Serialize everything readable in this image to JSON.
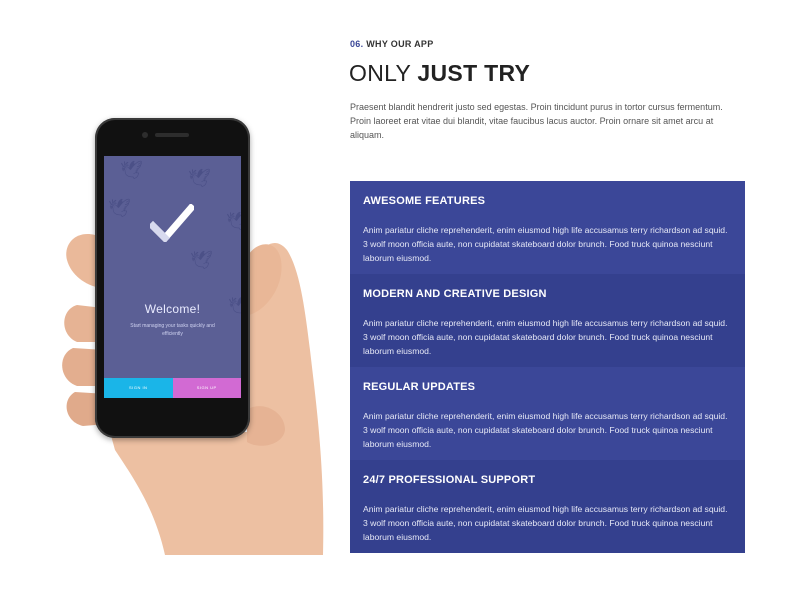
{
  "section": {
    "number": "06.",
    "eyebrow": "WHY OUR APP",
    "title_light": "ONLY",
    "title_bold": "JUST TRY",
    "intro": "Praesent blandit hendrerit justo sed egestas. Proin tincidunt purus in tortor cursus fermentum. Proin laoreet erat vitae dui blandit, vitae faucibus lacus auctor. Proin ornare sit amet arcu at aliquam."
  },
  "phone_screen": {
    "welcome": "Welcome!",
    "subtitle": "Start managing your tasks quickly and efficiently",
    "sign_in": "SIGN IN",
    "sign_up": "SIGN UP"
  },
  "features": [
    {
      "title": "AWESOME FEATURES",
      "text": "Anim pariatur cliche reprehenderit, enim eiusmod high life accusamus terry richardson ad squid. 3 wolf moon officia aute, non cupidatat skateboard dolor brunch. Food truck quinoa nesciunt laborum eiusmod."
    },
    {
      "title": "MODERN AND CREATIVE DESIGN",
      "text": "Anim pariatur cliche reprehenderit, enim eiusmod high life accusamus terry richardson ad squid. 3 wolf moon officia aute, non cupidatat skateboard dolor brunch. Food truck quinoa nesciunt laborum eiusmod."
    },
    {
      "title": "REGULAR UPDATES",
      "text": "Anim pariatur cliche reprehenderit, enim eiusmod high life accusamus terry richardson ad squid. 3 wolf moon officia aute, non cupidatat skateboard dolor brunch. Food truck quinoa nesciunt laborum eiusmod."
    },
    {
      "title": "24/7 PROFESSIONAL SUPPORT",
      "text": "Anim pariatur cliche reprehenderit, enim eiusmod high life accusamus terry richardson ad squid. 3 wolf moon officia aute, non cupidatat skateboard dolor brunch. Food truck quinoa nesciunt laborum eiusmod."
    }
  ],
  "colors": {
    "accent": "#3b4798",
    "panel_alt": "#34408e",
    "screen_bg": "#5b5f95",
    "sign_in": "#1ab5e8",
    "sign_up": "#d26ad3"
  },
  "icons": [
    "checkmark-icon",
    "bird-icon"
  ]
}
